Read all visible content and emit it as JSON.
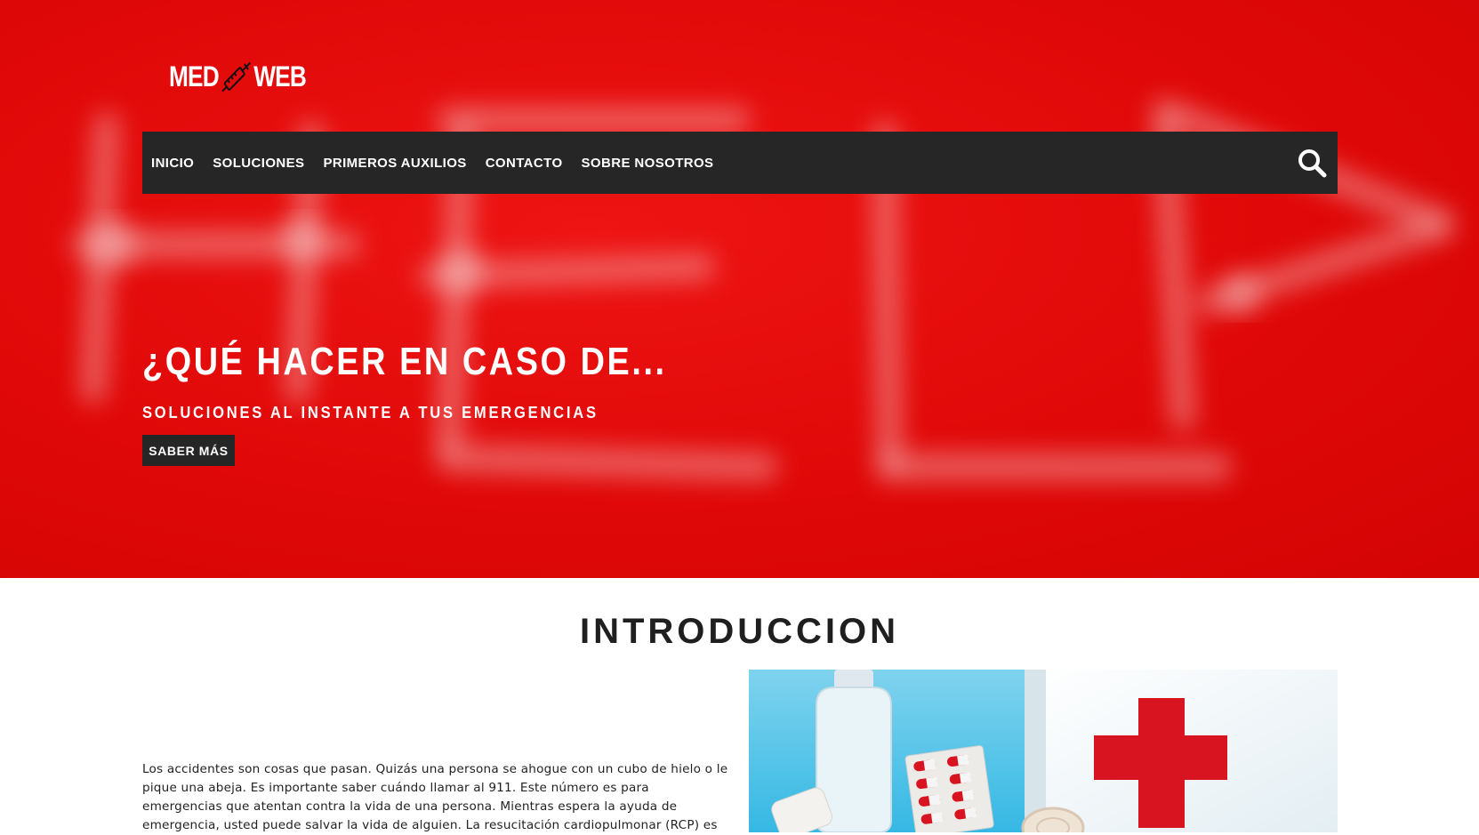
{
  "logo": {
    "left_text": "MED",
    "right_text": "WEB",
    "icon": "syringe-icon"
  },
  "hero_background": {
    "blurred_text": "HELP",
    "color": "#e30a0a"
  },
  "nav": {
    "items": [
      "INICIO",
      "SOLUCIONES",
      "PRIMEROS AUXILIOS",
      "CONTACTO",
      "SOBRE NOSOTROS"
    ],
    "search_icon": "search-icon"
  },
  "hero": {
    "title": "¿QUÉ HACER EN CASO DE...",
    "subtitle": "SOLUCIONES AL INSTANTE A TUS EMERGENCIAS",
    "button": "SABER MÁS"
  },
  "intro": {
    "title": "INTRODUCCION",
    "text": "Los accidentes son cosas que pasan. Quizás una persona se ahogue con un cubo de hielo o le pique una abeja. Es importante saber cuándo llamar al 911. Este número es para emergencias que atentan contra la vida de una persona. Mientras espera la ayuda de emergencia, usted puede salvar la vida de alguien. La resucitación cardiopulmonar (RCP) es",
    "image": "first-aid-kit-photo"
  },
  "colors": {
    "accent": "#e30a0a",
    "dark": "#262626",
    "text": "#222222"
  }
}
